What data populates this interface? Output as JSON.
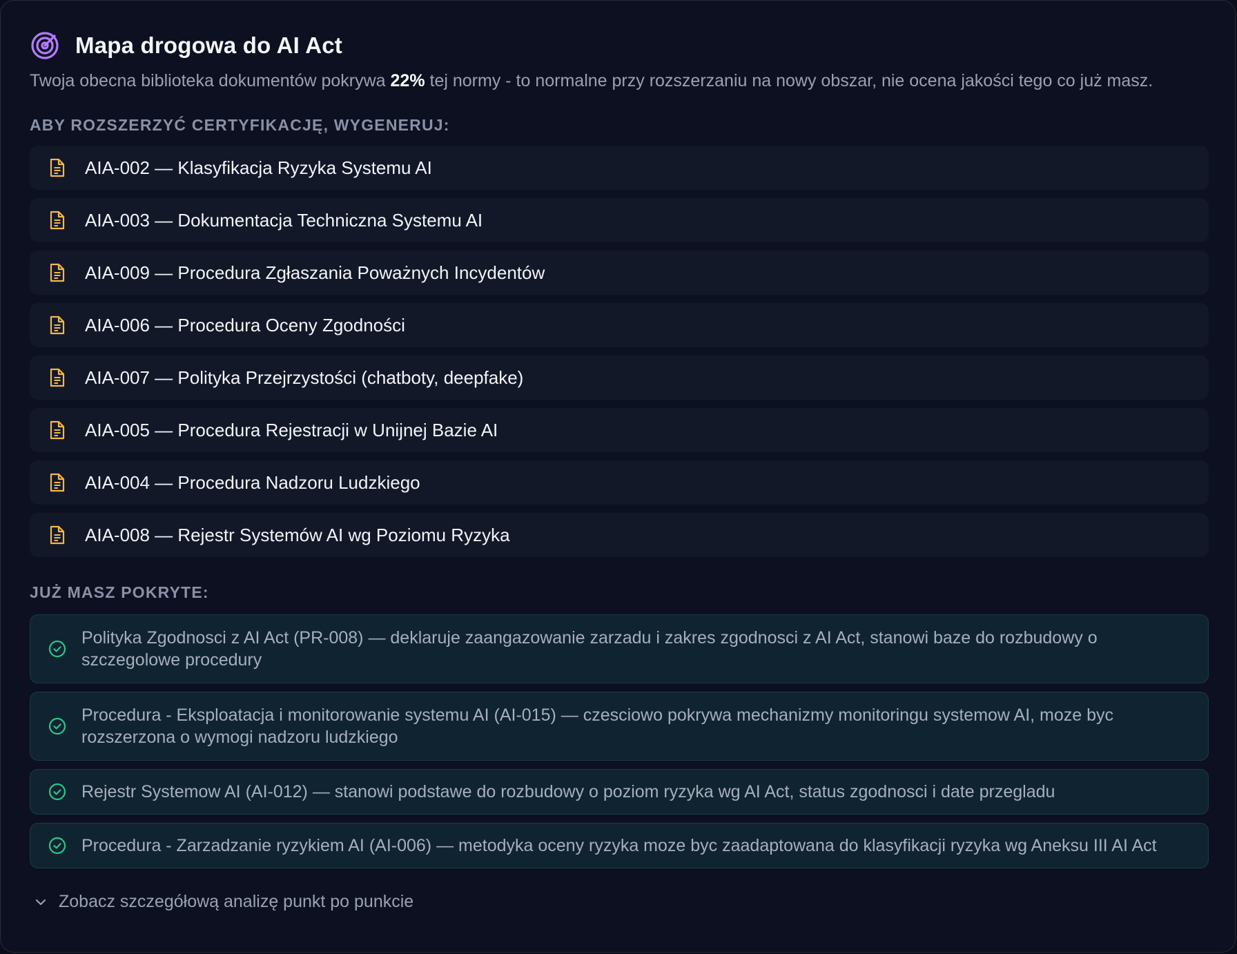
{
  "header": {
    "icon": "radar-target-icon",
    "title": "Mapa drogowa do AI Act",
    "subtitle_before": "Twoja obecna biblioteka dokumentów pokrywa ",
    "subtitle_pct": "22%",
    "subtitle_after": " tej normy - to normalne przy rozszerzaniu na nowy obszar, nie ocena jakości tego co już masz."
  },
  "colors": {
    "accent_purple": "#b57bff",
    "doc_icon": "#f1b84a",
    "check_green": "#2fc48a"
  },
  "todo": {
    "label": "ABY ROZSZERZYĆ CERTYFIKACJĘ, WYGENERUJ:",
    "items": [
      "AIA-002 — Klasyfikacja Ryzyka Systemu AI",
      "AIA-003 — Dokumentacja Techniczna Systemu AI",
      "AIA-009 — Procedura Zgłaszania Poważnych Incydentów",
      "AIA-006 — Procedura Oceny Zgodności",
      "AIA-007 — Polityka Przejrzystości (chatboty, deepfake)",
      "AIA-005 — Procedura Rejestracji w Unijnej Bazie AI",
      "AIA-004 — Procedura Nadzoru Ludzkiego",
      "AIA-008 — Rejestr Systemów AI wg Poziomu Ryzyka"
    ]
  },
  "covered": {
    "label": "JUŻ MASZ POKRYTE:",
    "items": [
      "Polityka Zgodnosci z AI Act (PR-008) — deklaruje zaangazowanie zarzadu i zakres zgodnosci z AI Act, stanowi baze do rozbudowy o szczegolowe procedury",
      "Procedura - Eksploatacja i monitorowanie systemu AI (AI-015) — czesciowo pokrywa mechanizmy monitoringu systemow AI, moze byc rozszerzona o wymogi nadzoru ludzkiego",
      "Rejestr Systemow AI (AI-012) — stanowi podstawe do rozbudowy o poziom ryzyka wg AI Act, status zgodnosci i date przegladu",
      "Procedura - Zarzadzanie ryzykiem AI (AI-006) — metodyka oceny ryzyka moze byc zaadaptowana do klasyfikacji ryzyka wg Aneksu III AI Act"
    ]
  },
  "expand": {
    "label": "Zobacz szczegółową analizę punkt po punkcie"
  }
}
